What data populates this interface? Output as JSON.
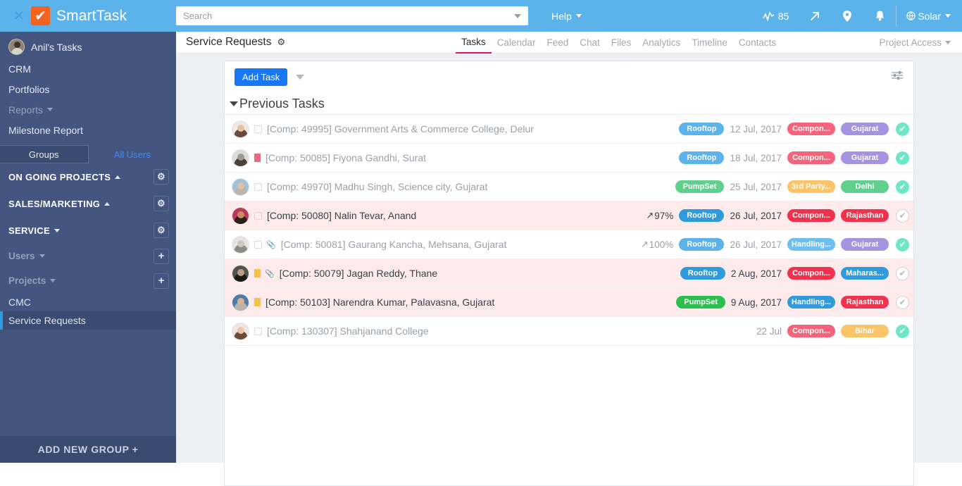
{
  "topbar": {
    "close_icon": "x-icon",
    "logo_glyph": "✔",
    "brand": "SmartTask",
    "search": {
      "value": "",
      "placeholder": "Search"
    },
    "help_label": "Help",
    "score": "85",
    "score_icon": "activity-chart-icon",
    "trend_icon": "trend-arrow-icon",
    "location_icon": "map-pin-icon",
    "bell_icon": "bell-icon",
    "user_label": "Solar",
    "user_icon": "globe-icon"
  },
  "sidebar": {
    "user": {
      "name": "Anil's Tasks",
      "avatar": "user-avatar"
    },
    "links": [
      {
        "label": "CRM"
      },
      {
        "label": "Portfolios"
      }
    ],
    "reports": {
      "label": "Reports",
      "child": "Milestone Report"
    },
    "tabs": [
      {
        "label": "Groups",
        "active": true
      },
      {
        "label": "All Users",
        "active": false
      }
    ],
    "groups": [
      {
        "label": "ON GOING PROJECTS",
        "caret": "up",
        "action": "gear-icon"
      },
      {
        "label": "SALES/MARKETING",
        "caret": "up",
        "action": "gear-icon"
      },
      {
        "label": "SERVICE",
        "caret": "down",
        "action": "gear-icon"
      }
    ],
    "sub_users": {
      "label": "Users",
      "action": "plus-icon"
    },
    "sub_projects": {
      "label": "Projects",
      "action": "plus-icon"
    },
    "projects": [
      {
        "label": "CMC",
        "active": false
      },
      {
        "label": "Service Requests",
        "active": true
      }
    ],
    "add_group": "ADD NEW GROUP",
    "add_group_plus": "+"
  },
  "main": {
    "title": "Service Requests",
    "title_gear": "gear-icon",
    "tabs": [
      {
        "label": "Tasks",
        "active": true
      },
      {
        "label": "Calendar",
        "active": false
      },
      {
        "label": "Feed",
        "active": false
      },
      {
        "label": "Chat",
        "active": false
      },
      {
        "label": "Files",
        "active": false
      },
      {
        "label": "Analytics",
        "active": false
      },
      {
        "label": "Timeline",
        "active": false
      },
      {
        "label": "Contacts",
        "active": false
      }
    ],
    "project_access": "Project Access"
  },
  "toolbar": {
    "add_task_label": "Add Task",
    "dropdown_icon": "chevron-down-icon",
    "filter_icon": "sliders-filter-icon"
  },
  "section": {
    "label": "Previous Tasks",
    "collapse_icon": "chevron-down-icon"
  },
  "tasks": [
    {
      "avatar_hair": "#6b4a3a",
      "avatar_skin": "#e8c3a5",
      "avatar_bg": "#f0eae6",
      "title": "[Comp: 49995] Government Arts & Commerce College, Delur",
      "dim": true,
      "flag": null,
      "clip": false,
      "percent": null,
      "type": {
        "label": "Rooftop",
        "color": "#5cb3ec"
      },
      "date": "12 Jul, 2017",
      "category": {
        "label": "Compon...",
        "color": "#f5647a"
      },
      "region": {
        "label": "Gujarat",
        "color": "#a593e0"
      },
      "done": true,
      "highlight": false
    },
    {
      "avatar_hair": "#4a4038",
      "avatar_skin": "#9b9b93",
      "avatar_bg": "#dedbd6",
      "title": "[Comp: 50085] Fiyona Gandhi, Surat",
      "dim": true,
      "flag": "#f5647a",
      "clip": false,
      "percent": null,
      "type": {
        "label": "Rooftop",
        "color": "#5cb3ec"
      },
      "date": "18 Jul, 2017",
      "category": {
        "label": "Compon...",
        "color": "#f5647a"
      },
      "region": {
        "label": "Gujarat",
        "color": "#a593e0"
      },
      "done": true,
      "highlight": false
    },
    {
      "avatar_hair": "#bdb5ab",
      "avatar_skin": "#e2c0a4",
      "avatar_bg": "#9fc3dc",
      "title": "[Comp: 49970] Madhu Singh, Science city, Gujarat",
      "dim": true,
      "flag": null,
      "clip": false,
      "percent": null,
      "type": {
        "label": "PumpSet",
        "color": "#5fd18c"
      },
      "date": "25 Jul, 2017",
      "category": {
        "label": "3rd Party...",
        "color": "#fcc468"
      },
      "region": {
        "label": "Delhi",
        "color": "#5fd18c"
      },
      "done": true,
      "highlight": false
    },
    {
      "avatar_hair": "#2a2017",
      "avatar_skin": "#c98a63",
      "avatar_bg": "#b9385a",
      "title": "[Comp: 50080] Nalin Tevar, Anand",
      "dim": false,
      "flag": null,
      "clip": false,
      "percent": "97%",
      "type": {
        "label": "Rooftop",
        "color": "#2f9bdd"
      },
      "date": "26 Jul, 2017",
      "category": {
        "label": "Compon...",
        "color": "#f0324f"
      },
      "region": {
        "label": "Rajasthan",
        "color": "#f0324f"
      },
      "done": false,
      "highlight": true
    },
    {
      "avatar_hair": "#8d8d85",
      "avatar_skin": "#c9c9c1",
      "avatar_bg": "#e6e4e0",
      "title": "[Comp: 50081] Gaurang Kancha, Mehsana, Gujarat",
      "dim": true,
      "flag": null,
      "clip": true,
      "percent": "100%",
      "type": {
        "label": "Rooftop",
        "color": "#5cb3ec"
      },
      "date": "26 Jul, 2017",
      "category": {
        "label": "Handling...",
        "color": "#6cbff0"
      },
      "region": {
        "label": "Gujarat",
        "color": "#a593e0"
      },
      "done": true,
      "highlight": false
    },
    {
      "avatar_hair": "#1c1914",
      "avatar_skin": "#b8a08c",
      "avatar_bg": "#55514c",
      "title": "[Comp: 50079] Jagan Reddy, Thane",
      "dim": false,
      "flag": "#f5c242",
      "clip": true,
      "percent": null,
      "type": {
        "label": "Rooftop",
        "color": "#2f9bdd"
      },
      "date": "2 Aug, 2017",
      "category": {
        "label": "Compon...",
        "color": "#f0324f"
      },
      "region": {
        "label": "Maharas...",
        "color": "#2f9bdd"
      },
      "done": false,
      "highlight": true
    },
    {
      "avatar_hair": "#b9b2a8",
      "avatar_skin": "#d9b294",
      "avatar_bg": "#4f7ba8",
      "title": "[Comp: 50103] Narendra Kumar, Palavasna, Gujarat",
      "dim": false,
      "flag": "#f5c242",
      "clip": false,
      "percent": null,
      "type": {
        "label": "PumpSet",
        "color": "#2bc04e"
      },
      "date": "9 Aug, 2017",
      "category": {
        "label": "Handling...",
        "color": "#2f9bdd"
      },
      "region": {
        "label": "Rajasthan",
        "color": "#f0324f"
      },
      "done": false,
      "highlight": true
    },
    {
      "avatar_hair": "#6d4a39",
      "avatar_skin": "#ecc7ab",
      "avatar_bg": "#efe7e2",
      "title": "[Comp: 130307] Shahjanand College",
      "dim": true,
      "flag": null,
      "clip": false,
      "percent": null,
      "type": null,
      "date": "22 Jul",
      "category": {
        "label": "Compon...",
        "color": "#f5647a"
      },
      "region": {
        "label": "Bihar",
        "color": "#fcc468"
      },
      "done": true,
      "highlight": false
    }
  ]
}
